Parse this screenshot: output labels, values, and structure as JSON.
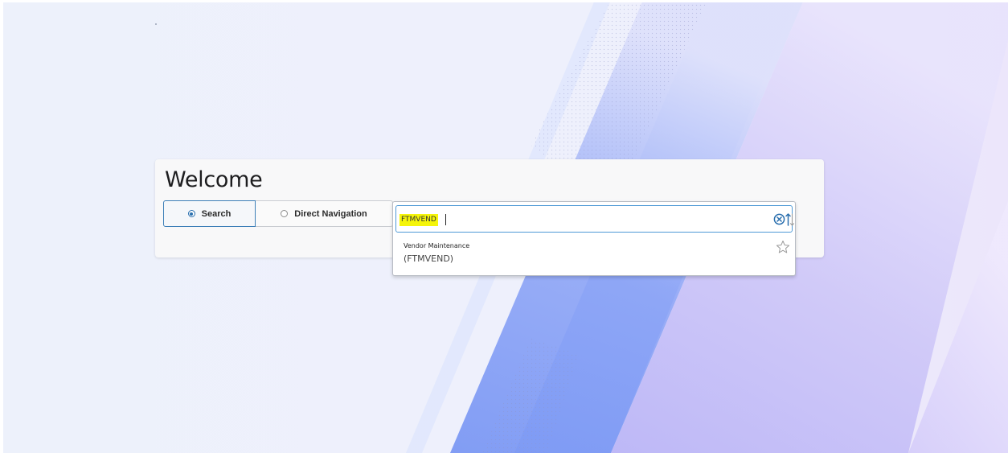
{
  "welcome": {
    "title": "Welcome"
  },
  "mode_toggle": {
    "options": [
      {
        "label": "Search",
        "selected": true
      },
      {
        "label": "Direct Navigation",
        "selected": false
      }
    ]
  },
  "search": {
    "value": "FTMVEND",
    "highlight_color": "#f5f50a",
    "clear_icon": "circle-x-icon",
    "sort_icon": "sort-arrows-icon"
  },
  "results": [
    {
      "title": "Vendor Maintenance",
      "code": "(FTMVEND)",
      "favorite_icon": "star-outline-icon"
    }
  ],
  "colors": {
    "accent": "#2a6fae",
    "field_border": "#4f9ad6",
    "background_purple": "#a9a5f2",
    "background_blue": "#6f90f3"
  }
}
